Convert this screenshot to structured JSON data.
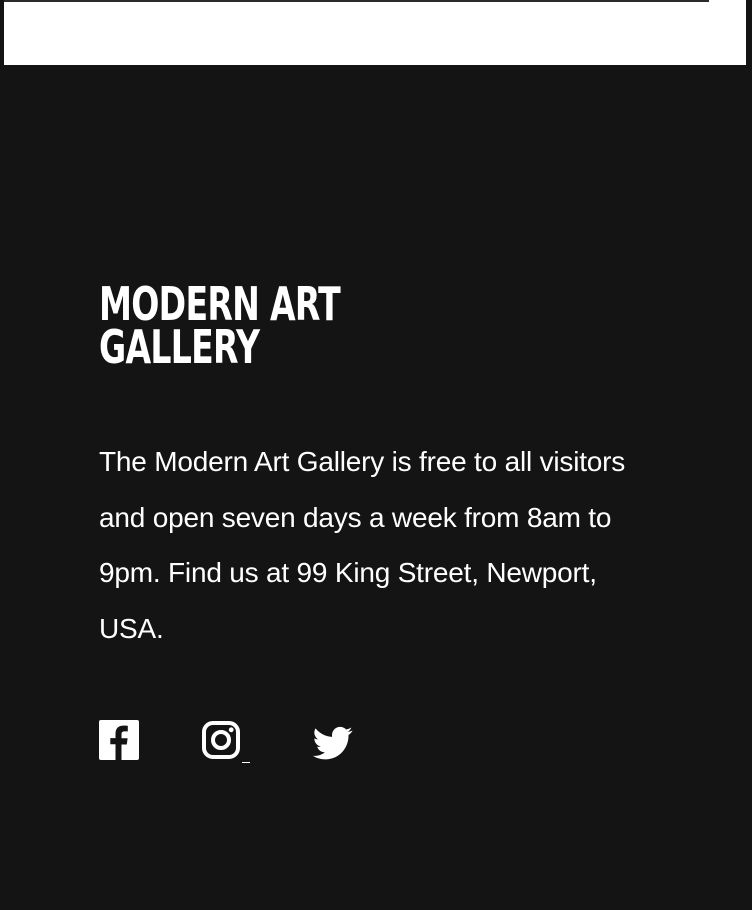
{
  "footer": {
    "brand": {
      "line1": "MODERN ART",
      "line2": "GALLERY"
    },
    "description": "The Modern Art Gallery is free to all visitors and open seven days a week from 8am to 9pm. Find us at 99 King Street, Newport, USA.",
    "social": {
      "facebook_icon": "facebook-icon",
      "instagram_icon": "instagram-icon",
      "twitter_icon": "twitter-icon"
    }
  },
  "colors": {
    "footer_background": "#141414",
    "text": "#ffffff",
    "top_panel": "#ffffff"
  }
}
